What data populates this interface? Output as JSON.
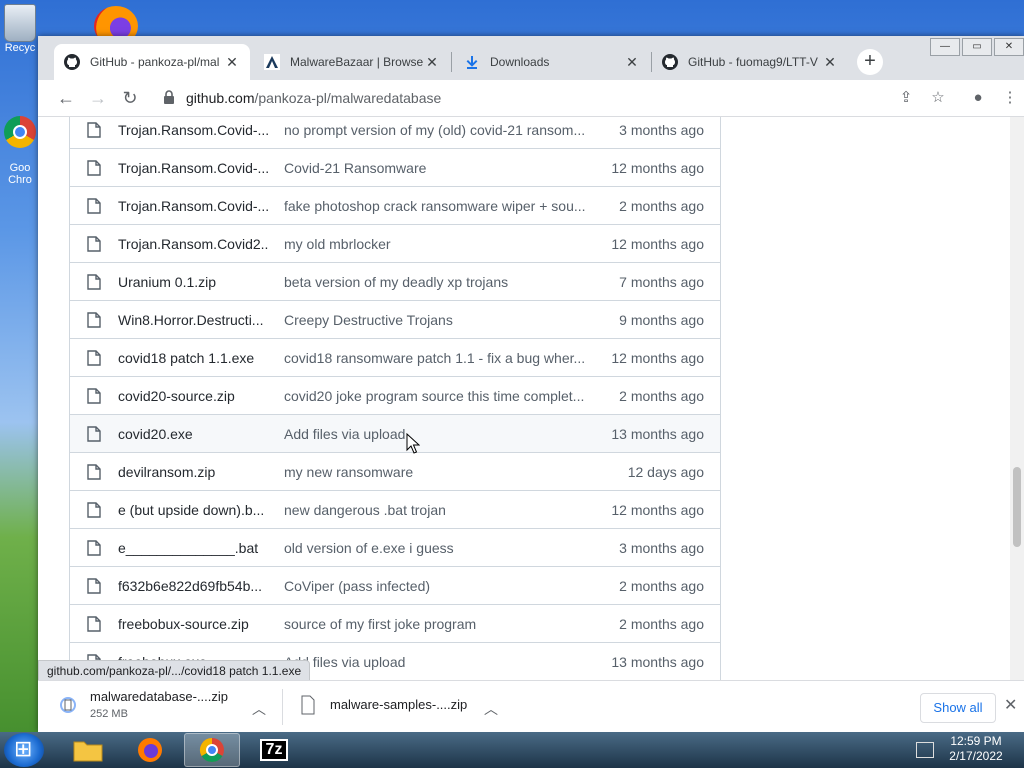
{
  "desktop": {
    "recycle_label": "Recyc",
    "chrome_label_1": "Goo",
    "chrome_label_2": "Chro"
  },
  "browser": {
    "tabs": [
      {
        "title": "GitHub - pankoza-pl/mal",
        "icon": "github-icon"
      },
      {
        "title": "MalwareBazaar | Browse",
        "icon": "malwarebazaar-icon"
      },
      {
        "title": "Downloads",
        "icon": "download-icon"
      },
      {
        "title": "GitHub - fuomag9/LTT-V",
        "icon": "github-icon"
      }
    ],
    "url_host": "github.com",
    "url_path": "/pankoza-pl/malwaredatabase"
  },
  "files": [
    {
      "name": "Trojan.Ransom.Covid-...",
      "message": "no prompt version of my (old) covid-21 ransom...",
      "age": "3 months ago"
    },
    {
      "name": "Trojan.Ransom.Covid-...",
      "message": "Covid-21 Ransomware",
      "age": "12 months ago"
    },
    {
      "name": "Trojan.Ransom.Covid-...",
      "message": "fake photoshop crack ransomware wiper + sou...",
      "age": "2 months ago"
    },
    {
      "name": "Trojan.Ransom.Covid2...",
      "message": "my old mbrlocker",
      "age": "12 months ago"
    },
    {
      "name": "Uranium 0.1.zip",
      "message": "beta version of my deadly xp trojans",
      "age": "7 months ago"
    },
    {
      "name": "Win8.Horror.Destructi...",
      "message": "Creepy Destructive Trojans",
      "age": "9 months ago"
    },
    {
      "name": "covid18 patch 1.1.exe",
      "message": "covid18 ransomware patch 1.1 - fix a bug wher...",
      "age": "12 months ago"
    },
    {
      "name": "covid20-source.zip",
      "message": "covid20 joke program source this time complet...",
      "age": "2 months ago"
    },
    {
      "name": "covid20.exe",
      "message": "Add files via upload",
      "age": "13 months ago"
    },
    {
      "name": "devilransom.zip",
      "message": "my new ransomware",
      "age": "12 days ago"
    },
    {
      "name": "e (but upside down).b...",
      "message": "new dangerous .bat trojan",
      "age": "12 months ago"
    },
    {
      "name": "e______________.bat",
      "message": "old version of e.exe i guess",
      "age": "3 months ago"
    },
    {
      "name": "f632b6e822d69fb54b...",
      "message": "CoViper (pass infected)",
      "age": "2 months ago"
    },
    {
      "name": "freebobux-source.zip",
      "message": "source of my first joke program",
      "age": "2 months ago"
    },
    {
      "name": "freebobux.exe",
      "message": "Add files via upload",
      "age": "13 months ago"
    }
  ],
  "status_url": "github.com/pankoza-pl/.../covid18 patch 1.1.exe",
  "downloads": [
    {
      "name": "malwaredatabase-....zip",
      "size": "252 MB"
    },
    {
      "name": "malware-samples-....zip",
      "size": ""
    }
  ],
  "show_all_label": "Show all",
  "clock": {
    "time": "12:59 PM",
    "date": "2/17/2022"
  },
  "taskbar": {
    "sevenzip_label": "7z"
  }
}
